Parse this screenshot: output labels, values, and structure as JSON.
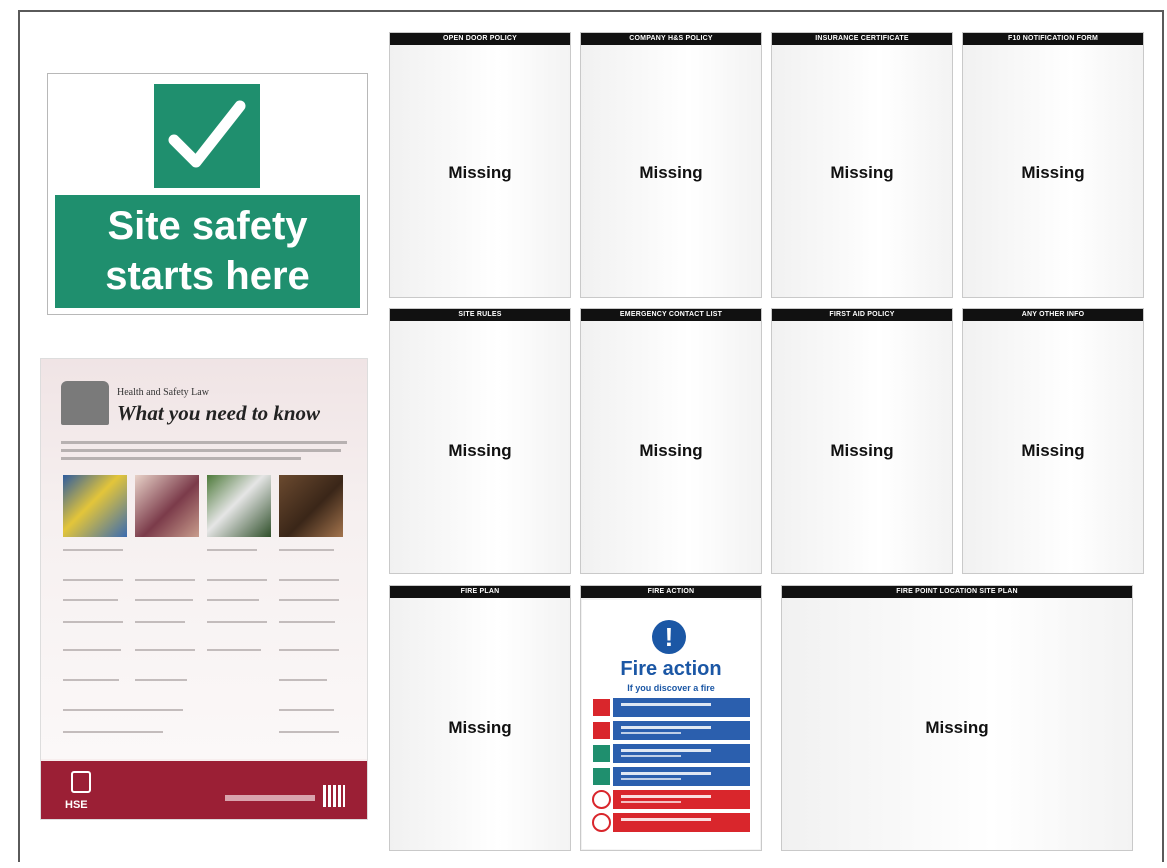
{
  "sign": {
    "line1": "Site safety",
    "line2": "starts here",
    "color": "#1f8f6e"
  },
  "poster": {
    "subtitle": "Health and Safety Law",
    "title": "What you need to know",
    "brand": "HSE",
    "footer_color": "#9b1f35"
  },
  "panels": [
    {
      "header": "OPEN DOOR POLICY",
      "status": "Missing"
    },
    {
      "header": "COMPANY H&S POLICY",
      "status": "Missing"
    },
    {
      "header": "INSURANCE CERTIFICATE",
      "status": "Missing"
    },
    {
      "header": "F10 NOTIFICATION FORM",
      "status": "Missing"
    },
    {
      "header": "SITE RULES",
      "status": "Missing"
    },
    {
      "header": "EMERGENCY CONTACT LIST",
      "status": "Missing"
    },
    {
      "header": "FIRST AID POLICY",
      "status": "Missing"
    },
    {
      "header": "ANY OTHER INFO",
      "status": "Missing"
    },
    {
      "header": "FIRE PLAN",
      "status": "Missing"
    },
    {
      "header": "FIRE ACTION",
      "status": ""
    },
    {
      "header": "FIRE POINT LOCATION SITE PLAN",
      "status": "Missing"
    }
  ],
  "fire_action": {
    "icon": "!",
    "title": "Fire action",
    "subtitle": "If you discover a fire",
    "rows": [
      {
        "color": "#2b5fae",
        "icon_color": "#d9262c"
      },
      {
        "color": "#2b5fae",
        "icon_color": "#d9262c"
      },
      {
        "color": "#2b5fae",
        "icon_color": "#1f8f6e"
      },
      {
        "color": "#2b5fae",
        "icon_color": "#1f8f6e"
      },
      {
        "color": "#d9262c",
        "icon_color": "#ffffff"
      },
      {
        "color": "#d9262c",
        "icon_color": "#ffffff"
      }
    ]
  }
}
